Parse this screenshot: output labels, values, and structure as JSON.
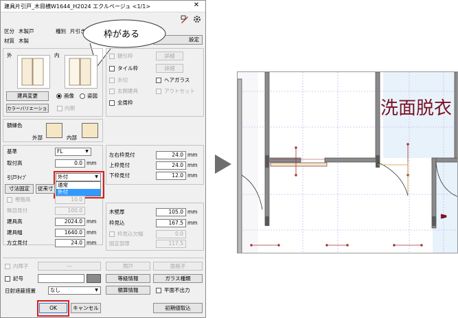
{
  "window": {
    "title": "建具片引戸_木目横W1644_H2024 エクルページュ <1/1>",
    "close": "✕"
  },
  "info": {
    "kubun_label": "区分",
    "kubun_value": "木製戸",
    "shubetsu_label": "種別",
    "shubetsu_value": "片引き",
    "zaishitsu_label": "材質",
    "zaishitsu_value": "木製",
    "settings_button": "設定"
  },
  "callout": {
    "text": "枠がある"
  },
  "preview": {
    "outer_label": "外",
    "inner_label": "内",
    "change_button": "建具変更",
    "radio_image": "画像",
    "radio_elevation": "姿図",
    "color_variation_button": "カラーバリエーション",
    "inner_check": "内側"
  },
  "options": {
    "kamaichi_frame": "額引枠",
    "tile_frame": "タイル枠",
    "mizukiri": "水切",
    "air_tight": "ヘアガラス",
    "entrance": "玄関建具",
    "outset": "アウトセット",
    "full_frame": "全周枠",
    "detail1": "詳細",
    "detail2": "詳細"
  },
  "frame_color": {
    "title": "額縁色",
    "outer": "外部",
    "inner": "内部"
  },
  "left_fields": {
    "base_label": "基準",
    "base_value": "FL",
    "height_label": "取付高",
    "height_value": "0.0",
    "unit": "mm"
  },
  "door_type": {
    "label": "引戸ﾀｲﾌﾟ",
    "selected": "外付",
    "options": [
      "通常",
      "外付"
    ]
  },
  "fix_button": "寸法固定",
  "fix_button2": "従来寸",
  "lower_left": {
    "kamachi_label": "樫階高",
    "kamachi_value": "10.0",
    "mu_label": "無目見付",
    "mu_value": "100.0",
    "h_label": "建具高",
    "h_value": "2024.0",
    "w_label": "建具幅",
    "w_value": "1640.0",
    "side_label": "方立見付",
    "side_value": "24.0",
    "unit": "mm"
  },
  "right_fields": {
    "lr_label": "左右枠見付",
    "lr_value": "24.0",
    "top_label": "上枠見付",
    "top_value": "24.0",
    "bottom_label": "下枠見付",
    "bottom_value": "12.0",
    "wall_label": "木壁厚",
    "wall_value": "105.0",
    "depth_label": "枠見込",
    "depth_value": "167.5",
    "lack_label": "枠見込欠幅",
    "lack_value": "0.0",
    "fixed_label": "固定部厚",
    "fixed_value": "117.5",
    "unit": "mm"
  },
  "bottom": {
    "naishoji": "内障子",
    "naishoji_value": "---",
    "amado": "雨戸",
    "mengoshi": "面格子",
    "kigo": "記号",
    "grade_btn": "等級情報",
    "glass_btn": "ガラス種類",
    "shade_label": "日射遮蔽措置",
    "shade_value": "なし",
    "sekisan_btn": "積算情報",
    "plan_check": "平面不出力",
    "ok": "OK",
    "cancel": "キャンセル",
    "init_btn": "初期値取込"
  },
  "plan": {
    "room_label": "洗面脱衣"
  },
  "colors": {
    "highlight_red": "#d61e1e",
    "select_blue": "#3399ff",
    "room_text": "#7a1022"
  }
}
